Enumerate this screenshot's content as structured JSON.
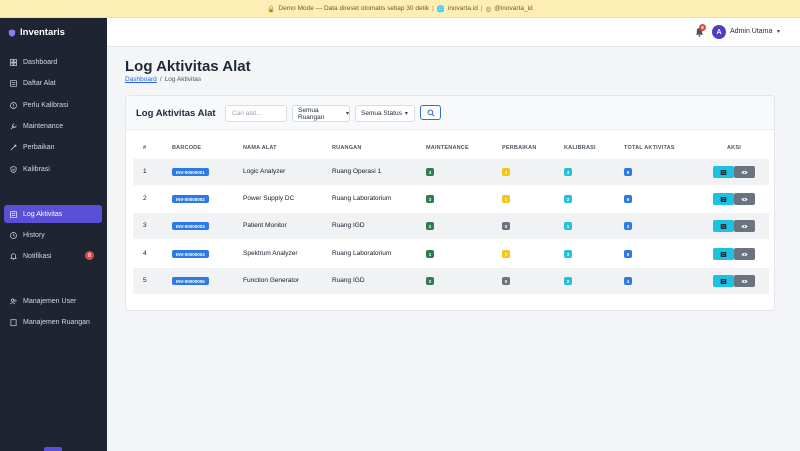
{
  "banner": {
    "lock": "🔒",
    "text": "Demo Mode — Data direset otomatis setiap 30 detik",
    "site": "inovarta.id",
    "handle": "@inovarta_id"
  },
  "app": {
    "name": "Inventaris"
  },
  "sidebar": {
    "items": [
      {
        "label": "Dashboard",
        "icon": "grid-icon"
      },
      {
        "label": "Daftar Alat",
        "icon": "list-icon"
      },
      {
        "label": "Perlu Kalibrasi",
        "icon": "alert-icon"
      },
      {
        "label": "Maintenance",
        "icon": "wrench-icon"
      },
      {
        "label": "Perbaikan",
        "icon": "tool-icon"
      },
      {
        "label": "Kalibrasi",
        "icon": "shield-check-icon"
      },
      {
        "label": "Log Aktivitas",
        "icon": "list-icon",
        "active": true
      },
      {
        "label": "History",
        "icon": "clock-icon"
      },
      {
        "label": "Notifikasi",
        "icon": "bell-icon",
        "badge": "8"
      },
      {
        "label": "Manajemen User",
        "icon": "users-icon"
      },
      {
        "label": "Manajemen Ruangan",
        "icon": "building-icon"
      }
    ]
  },
  "topbar": {
    "bell_badge": "8",
    "avatar": "A",
    "user": "Admin Utama"
  },
  "page": {
    "title": "Log Aktivitas Alat",
    "breadcrumb_home": "Dashboard",
    "breadcrumb_sep": "/",
    "breadcrumb_current": "Log Aktivitas"
  },
  "card": {
    "title": "Log Aktivitas Alat",
    "search_placeholder": "Cari alat...",
    "room_filter": "Semua Ruangan",
    "status_filter": "Semua Status"
  },
  "table": {
    "headers": [
      "#",
      "BARCODE",
      "NAMA ALAT",
      "RUANGAN",
      "MAINTENANCE",
      "PERBAIKAN",
      "KALIBRASI",
      "TOTAL AKTIVITAS",
      "AKSI"
    ],
    "rows": [
      {
        "no": "1",
        "barcode": "INV-00000001",
        "name": "Logic Analyzer",
        "room": "Ruang Operasi 1",
        "maintenance": "3",
        "perbaikan": "3",
        "kalibrasi": "3",
        "total": "9"
      },
      {
        "no": "2",
        "barcode": "INV-00000002",
        "name": "Power Supply DC",
        "room": "Ruang Laboratorium",
        "maintenance": "3",
        "perbaikan": "1",
        "kalibrasi": "2",
        "total": "6"
      },
      {
        "no": "3",
        "barcode": "INV-00000003",
        "name": "Patient Monitor",
        "room": "Ruang IGD",
        "maintenance": "2",
        "perbaikan": "0",
        "kalibrasi": "1",
        "total": "3"
      },
      {
        "no": "4",
        "barcode": "INV-00000004",
        "name": "Spektrum Analyzer",
        "room": "Ruang Laboratorium",
        "maintenance": "1",
        "perbaikan": "2",
        "kalibrasi": "3",
        "total": "6"
      },
      {
        "no": "5",
        "barcode": "INV-00000005",
        "name": "Function Generator",
        "room": "Ruang IGD",
        "maintenance": "2",
        "perbaikan": "0",
        "kalibrasi": "2",
        "total": "4"
      }
    ]
  },
  "colors": {
    "maintenance": "#2e7d4f",
    "perbaikan_active": "#f5c518",
    "perbaikan_zero": "#6b7280",
    "kalibrasi": "#22c1dc",
    "total": "#2c7be5",
    "action_primary": "#1fc1e0",
    "action_secondary": "#6b7280"
  }
}
